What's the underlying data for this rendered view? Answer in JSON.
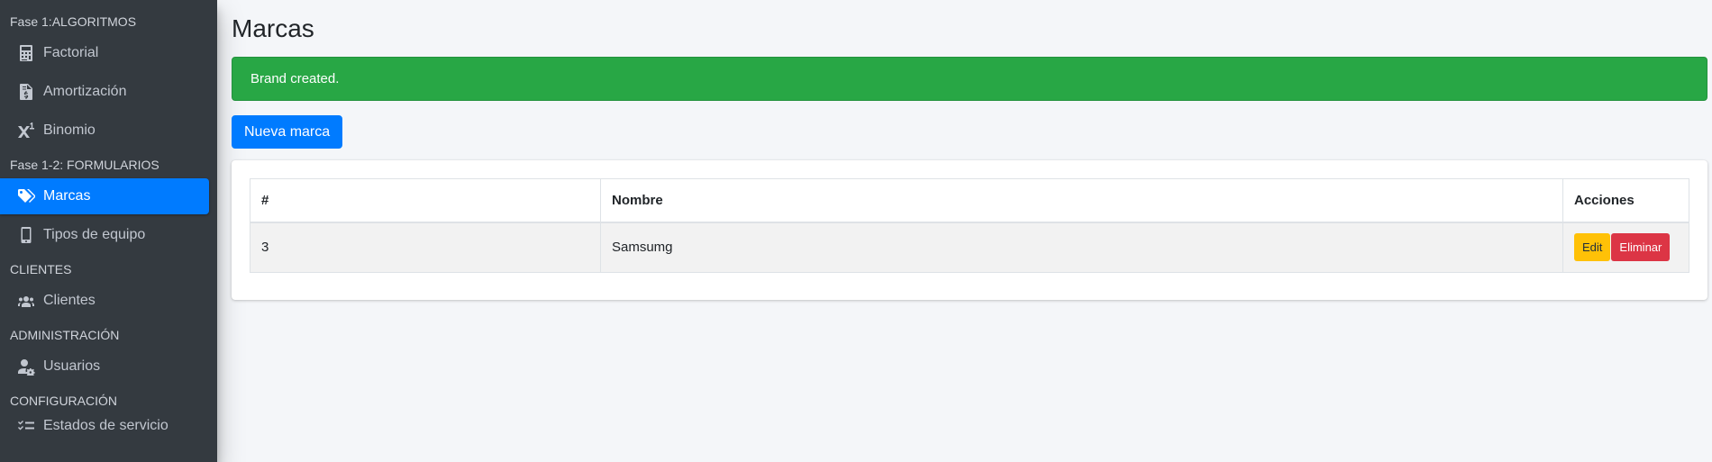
{
  "sidebar": {
    "sections": [
      {
        "header": "Fase 1:ALGORITMOS",
        "items": [
          {
            "label": "Factorial",
            "icon": "calculator-icon"
          },
          {
            "label": "Amortización",
            "icon": "file-invoice-dollar-icon"
          },
          {
            "label": "Binomio",
            "icon": "superscript-icon"
          }
        ]
      },
      {
        "header": "Fase 1-2: FORMULARIOS",
        "items": [
          {
            "label": "Marcas",
            "icon": "tags-icon",
            "active": true
          },
          {
            "label": "Tipos de equipo",
            "icon": "mobile-icon"
          }
        ]
      },
      {
        "header": "CLIENTES",
        "items": [
          {
            "label": "Clientes",
            "icon": "users-icon"
          }
        ]
      },
      {
        "header": "ADMINISTRACIÓN",
        "items": [
          {
            "label": "Usuarios",
            "icon": "user-cog-icon"
          }
        ]
      },
      {
        "header": "CONFIGURACIÓN",
        "items": [
          {
            "label": "Estados de servicio",
            "icon": "tasks-icon"
          }
        ]
      }
    ]
  },
  "main": {
    "title": "Marcas",
    "alert": "Brand created.",
    "new_button": "Nueva marca",
    "table": {
      "headers": [
        "#",
        "Nombre",
        "Acciones"
      ],
      "rows": [
        {
          "id": "3",
          "name": "Samsumg",
          "edit": "Edit",
          "delete": "Eliminar"
        }
      ]
    }
  },
  "colors": {
    "sidebar_bg": "#343a40",
    "active": "#007bff",
    "success": "#28a745",
    "warning": "#ffc107",
    "danger": "#dc3545"
  }
}
